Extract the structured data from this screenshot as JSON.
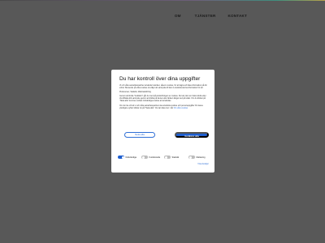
{
  "nav": {
    "items": [
      {
        "label": "OM"
      },
      {
        "label": "TJÄNSTER"
      },
      {
        "label": "KONTAKT"
      }
    ]
  },
  "consent": {
    "title": "Du har kontroll över dina uppgifter",
    "paragraph1": "Vi och våra samarbetspartner använder tekniker, såsom cookies, för att lagra och läsa information på din enhet. Beroende på vilka cookies du väljer att samtycka till kan vi använda denna information för att:",
    "purposes": "Preferenser, Statistik, Marknadsföring",
    "paragraph2": "Genom att klicka \"Godkänn\" går du med på användningen av cookies. Du kan när som helst ändra eller dra tillbaka ditt samtycke genom att klicka på ikonen eller länken längst ned på sidan. Om du klickar på \"Neka alla\" kommer endast nödvändiga cookies att användas.",
    "paragraph3": "Om du inte vill att vi och våra samarbetspartner ska använda cookies och personuppgifter för dessa ytterligare syften klickar du på \"Neka alla\". Du kan läsa mer i vår",
    "policy_link": "Om våra cookies",
    "deny_label": "Neka alla",
    "accept_label": "Godkänn alla",
    "toggles": [
      {
        "label": "Nödvändiga",
        "on": true
      },
      {
        "label": "Funktionella",
        "on": false
      },
      {
        "label": "Statistik",
        "on": false
      },
      {
        "label": "Marketing",
        "on": false
      }
    ],
    "details_link": "Visa detaljer"
  }
}
